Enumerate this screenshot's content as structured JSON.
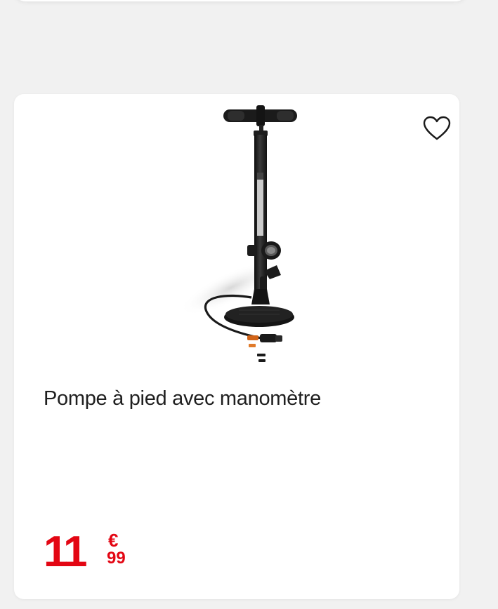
{
  "product": {
    "title": "Pompe à pied avec manomètre",
    "price": {
      "integer": "11",
      "currency": "€",
      "cents": "99"
    },
    "image_alt": "floor-pump-image",
    "wishlist_icon": "heart-icon"
  },
  "colors": {
    "price": "#e30613",
    "title": "#1f1f1f",
    "card_background": "#ffffff",
    "page_background": "#f1f1f1"
  }
}
